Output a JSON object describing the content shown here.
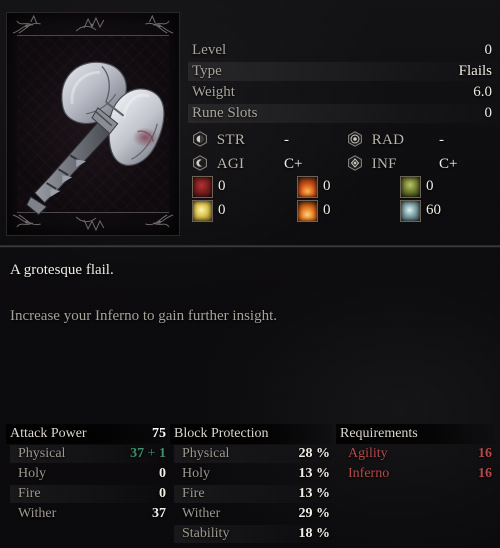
{
  "item": {
    "art_name": "grotesque-flail-weapon-art",
    "frame_name": "item-portrait-frame"
  },
  "header_stats": [
    {
      "label": "Level",
      "value": "0",
      "shaded": false
    },
    {
      "label": "Type",
      "value": "Flails",
      "shaded": true
    },
    {
      "label": "Weight",
      "value": "6.0",
      "shaded": false
    },
    {
      "label": "Rune Slots",
      "value": "0",
      "shaded": true
    }
  ],
  "scaling": [
    {
      "icon": "strength-icon",
      "label": "STR",
      "grade": "-"
    },
    {
      "icon": "radiance-icon",
      "label": "RAD",
      "grade": "-"
    },
    {
      "icon": "agility-icon",
      "label": "AGI",
      "grade": "C+"
    },
    {
      "icon": "inferno-icon",
      "label": "INF",
      "grade": "C+"
    }
  ],
  "elements": [
    {
      "icon": "blood-damage-icon",
      "value": "0"
    },
    {
      "icon": "fire-damage-icon",
      "value": "0"
    },
    {
      "icon": "wither-damage-icon",
      "value": "0"
    },
    {
      "icon": "holy-damage-icon",
      "value": "0"
    },
    {
      "icon": "inferno-damage-icon",
      "value": "0"
    },
    {
      "icon": "frost-insight-icon",
      "value": "60"
    }
  ],
  "description": {
    "title": "A grotesque flail.",
    "body": "Increase your Inferno to gain further insight."
  },
  "panels": {
    "attack_power": {
      "title": "Attack Power",
      "total": "75",
      "rows": [
        {
          "label": "Physical",
          "value_base": "37",
          "value_plus": "+",
          "value_bonus": "1",
          "shaded": true
        },
        {
          "label": "Holy",
          "value": "0",
          "shaded": false
        },
        {
          "label": "Fire",
          "value": "0",
          "shaded": true
        },
        {
          "label": "Wither",
          "value": "37",
          "shaded": false
        }
      ]
    },
    "block_protection": {
      "title": "Block Protection",
      "rows": [
        {
          "label": "Physical",
          "value": "28 %",
          "shaded": true
        },
        {
          "label": "Holy",
          "value": "13 %",
          "shaded": false
        },
        {
          "label": "Fire",
          "value": "13 %",
          "shaded": true
        },
        {
          "label": "Wither",
          "value": "29 %",
          "shaded": false
        },
        {
          "label": "Stability",
          "value": "18 %",
          "shaded": true
        }
      ]
    },
    "requirements": {
      "title": "Requirements",
      "rows": [
        {
          "label": "Agility",
          "value": "16"
        },
        {
          "label": "Inferno",
          "value": "16"
        }
      ]
    }
  },
  "colors": {
    "background": "#0c0b0d",
    "label": "#a9a49b",
    "value": "#efece4",
    "bonus_green": "#3f8f6d",
    "requirement_red": "#b4484a"
  }
}
